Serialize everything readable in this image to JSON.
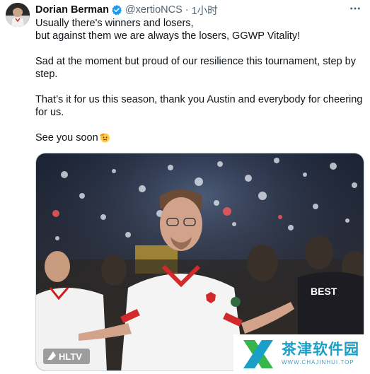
{
  "tweet": {
    "author_name": "Dorian Berman",
    "handle": "@xertioNCS",
    "separator": "·",
    "time": "1小时",
    "body": {
      "line1": "Usually there's winners and losers,",
      "line2": "but against them we are always the losers, GGWP Vitality!",
      "line3": "Sad at the moment but proud of our resilience this tournament, step by step.",
      "line4": "That’s it for us this season, thank you Austin and everybody for cheering for us.",
      "line5": "See you soon"
    },
    "media": {
      "source_label": "HLTV",
      "jersey_text": "BEST"
    }
  },
  "watermark": {
    "name": "茶津软件园",
    "url": "WWW.CHAJINHUI.TOP"
  },
  "icons": {
    "verified": "verified-badge-icon",
    "more": "more-options-icon",
    "emoji": "saluting-face-emoji"
  },
  "colors": {
    "text": "#0f1419",
    "secondary": "#536471",
    "verified_blue": "#1d9bf0",
    "watermark_green": "#35b54a",
    "watermark_blue": "#1aa0c8"
  }
}
